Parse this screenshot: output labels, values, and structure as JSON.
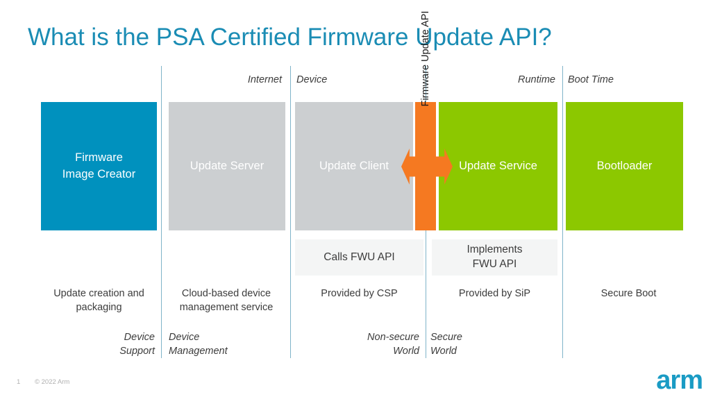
{
  "slide": {
    "title": "What is the PSA Certified Firmware Update API?",
    "page_number": "1",
    "copyright": "© 2022 Arm",
    "logo": "arm"
  },
  "colors": {
    "title": "#1a8cb4",
    "blue_block": "#0091be",
    "gray_block": "#cccfd1",
    "green_block": "#8cc800",
    "orange_api": "#f57921",
    "divider": "#7fb4c9",
    "subbox_bg": "#f4f5f5",
    "body_text": "#3c3c3c",
    "footer_text": "#b0b0b0",
    "logo": "#1a9bc4"
  },
  "region_labels": [
    {
      "text": "Internet",
      "align": "right"
    },
    {
      "text": "Device",
      "align": "left"
    },
    {
      "text": "Runtime",
      "align": "right"
    },
    {
      "text": "Boot Time",
      "align": "left"
    }
  ],
  "blocks": [
    {
      "label": "Firmware\nImage Creator",
      "color": "blue"
    },
    {
      "label": "Update Server",
      "color": "gray"
    },
    {
      "label": "Update Client",
      "color": "gray"
    },
    {
      "label": "Update Service",
      "color": "green"
    },
    {
      "label": "Bootloader",
      "color": "green"
    }
  ],
  "api_bar": {
    "label": "Firmware Update API",
    "arrow": "double-headed-horizontal-arrow"
  },
  "sub_boxes": [
    {
      "label": "Calls FWU API"
    },
    {
      "label": "Implements\nFWU API"
    }
  ],
  "descriptions": [
    {
      "text": "Update creation and\npackaging"
    },
    {
      "text": "Cloud-based device\nmanagement service"
    },
    {
      "text": "Provided by CSP"
    },
    {
      "text": "Provided by SiP"
    },
    {
      "text": "Secure Boot"
    }
  ],
  "world_labels": [
    {
      "text": "Device\nSupport",
      "align": "right"
    },
    {
      "text": "Device\nManagement",
      "align": "left"
    },
    {
      "text": "Non-secure\nWorld",
      "align": "right"
    },
    {
      "text": "Secure\nWorld",
      "align": "left"
    }
  ]
}
